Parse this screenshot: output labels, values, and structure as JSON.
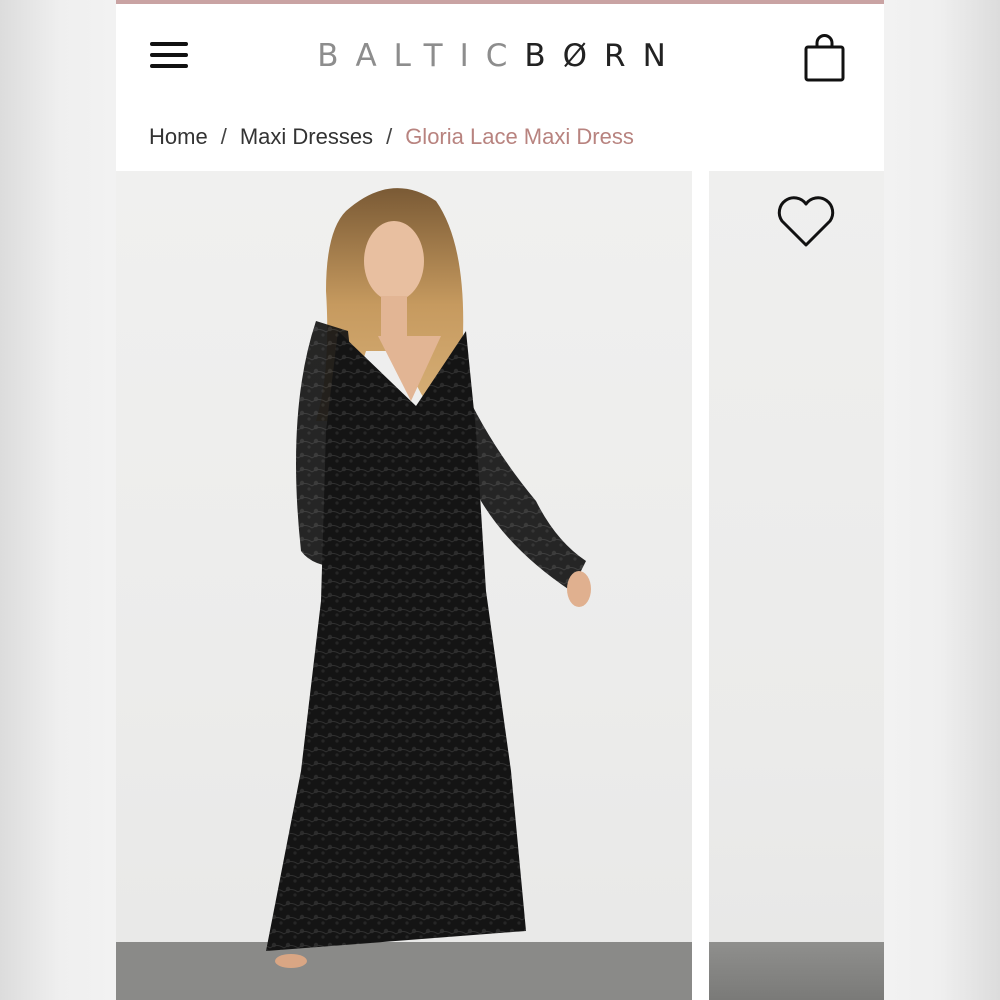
{
  "brand": {
    "part1": "BALTIC",
    "part2": "BØRN"
  },
  "breadcrumb": {
    "items": [
      "Home",
      "Maxi Dresses"
    ],
    "separator": "/",
    "current": "Gloria Lace Maxi Dress"
  },
  "icons": {
    "menu": "hamburger-menu-icon",
    "bag": "shopping-bag-icon",
    "favorite": "heart-outline-icon"
  },
  "colors": {
    "accent": "#c9a3a3",
    "breadcrumb_current": "#b8837f",
    "text": "#333333",
    "logo_light": "#8d8d8d",
    "logo_dark": "#222222"
  },
  "gallery": {
    "images": [
      "model-wearing-black-lace-maxi-dress",
      "next-product-photo-partial"
    ]
  }
}
